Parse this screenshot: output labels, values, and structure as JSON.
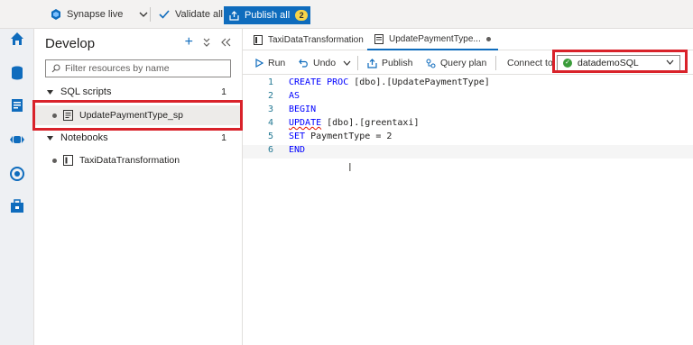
{
  "topbar": {
    "workspace": "Synapse live",
    "validate_label": "Validate all",
    "publish_label": "Publish all",
    "publish_badge": "2"
  },
  "activity": {
    "items": [
      "home-icon",
      "data-icon",
      "develop-icon",
      "integrate-icon",
      "monitor-icon",
      "manage-icon"
    ],
    "collapse_label": "»"
  },
  "develop": {
    "title": "Develop",
    "filter_placeholder": "Filter resources by name",
    "sql_section": {
      "label": "SQL scripts",
      "count": "1"
    },
    "sql_items": [
      {
        "label": "UpdatePaymentType_sp"
      }
    ],
    "notebook_section": {
      "label": "Notebooks",
      "count": "1"
    },
    "notebook_items": [
      {
        "label": "TaxiDataTransformation"
      }
    ]
  },
  "tabs": [
    {
      "label": "TaxiDataTransformation"
    },
    {
      "label": "UpdatePaymentType..."
    }
  ],
  "commands": {
    "run": "Run",
    "undo": "Undo",
    "publish": "Publish",
    "query_plan": "Query plan",
    "connect_to": "Connect to",
    "connection": "datademoSQL"
  },
  "editor": {
    "lines": [
      {
        "n": "1",
        "kw": "CREATE PROC",
        "rest": " [dbo].[UpdatePaymentType]"
      },
      {
        "n": "2",
        "kw": "AS",
        "rest": ""
      },
      {
        "n": "3",
        "kw": "BEGIN",
        "rest": ""
      },
      {
        "n": "4",
        "kw": "UPDATE",
        "rest": " [dbo].[greentaxi]"
      },
      {
        "n": "5",
        "kw": "SET",
        "rest": " PaymentType = 2"
      },
      {
        "n": "6",
        "kw": "END",
        "rest": ""
      }
    ]
  },
  "colors": {
    "accent": "#0f6cbd",
    "highlight": "#d9222a",
    "keyword": "#0000ff",
    "connected": "#3a9c3a"
  }
}
